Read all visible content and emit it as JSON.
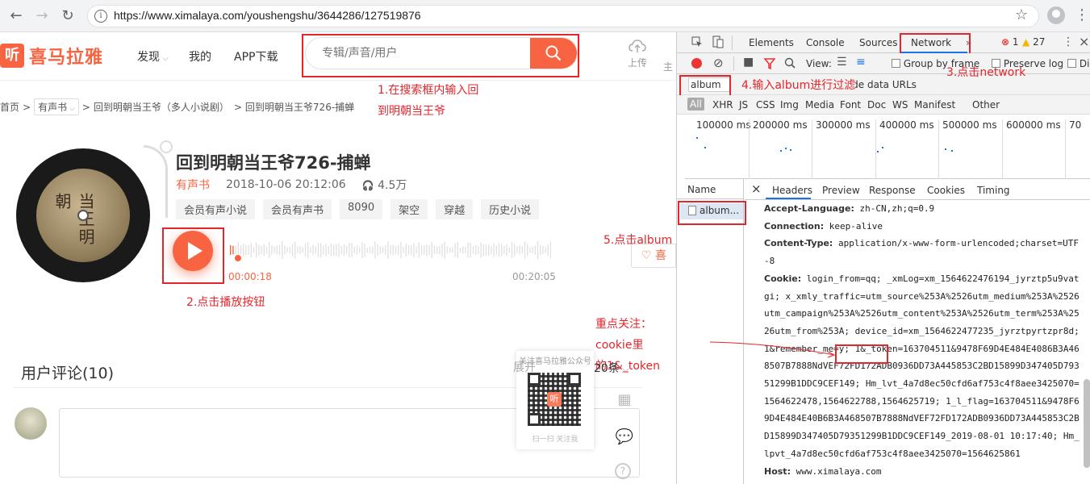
{
  "browser": {
    "url": "https://www.ximalaya.com/youshengshu/3644286/127519876",
    "back_icon": "←",
    "forward_icon": "→",
    "reload_icon": "↻",
    "info_icon": "i",
    "star_icon": "☆",
    "menu_icon": "⋮"
  },
  "site": {
    "logo_mark": "听",
    "logo_text": "喜马拉雅",
    "nav": [
      "发现",
      "我的",
      "APP下载"
    ],
    "search_placeholder": "专辑/声音/用户",
    "upload_label": "上传",
    "host_label": "主",
    "breadcrumb": {
      "home": "首页",
      "sep": ">",
      "category": "有声书",
      "album": "回到明朝当王爷（多人小说剧）",
      "track": "回到明朝当王爷726-捕蝉"
    },
    "cover_text": "当王明朝",
    "track": {
      "title": "回到明朝当王爷726-捕蝉",
      "category": "有声书",
      "date": "2018-10-06 20:12:06",
      "plays": "4.5万",
      "tags": [
        "会员有声小说",
        "会员有声书",
        "8090",
        "架空",
        "穿越",
        "历史小说"
      ],
      "progress_fraction": 0.0149,
      "current_time": "00:00:18",
      "duration": "00:20:05"
    },
    "like_label": "喜",
    "comments": {
      "title": "用户评论(10)",
      "sort": "20条"
    },
    "qr": {
      "overlay_text": "展开",
      "header": "关注喜马拉雅公众号",
      "logo": "听",
      "footer": "扫一扫 关注我"
    },
    "annotations": {
      "a1_line1": "1.在搜索框内输入回",
      "a1_line2": "到明朝当王爷",
      "a2": "2.点击播放按钮",
      "a3": "3.点击network",
      "a4": "4.输入album进行过滤",
      "a5": "5.点击album",
      "focus_line1": "重点关注：cookie里",
      "focus_line2": "的1&_token"
    }
  },
  "devtools": {
    "tabs": [
      "Elements",
      "Console",
      "Sources",
      "Network"
    ],
    "active_tab": "Network",
    "errors": "1",
    "warnings": "27",
    "view_label": "View:",
    "group_by_frame": "Group by frame",
    "preserve_log": "Preserve log",
    "disable_cache": "Di",
    "filter_value": "album",
    "hide_data_urls": "Hide data URLs",
    "types": [
      "All",
      "XHR",
      "JS",
      "CSS",
      "Img",
      "Media",
      "Font",
      "Doc",
      "WS",
      "Manifest",
      "Other"
    ],
    "timeline_ticks": [
      "100000 ms",
      "200000 ms",
      "300000 ms",
      "400000 ms",
      "500000 ms",
      "600000 ms",
      "70"
    ],
    "name_header": "Name",
    "request_name": "album...",
    "detail_tabs": [
      "Headers",
      "Preview",
      "Response",
      "Cookies",
      "Timing"
    ],
    "headers": [
      {
        "k": "Accept-Language:",
        "v": "zh-CN,zh;q=0.9"
      },
      {
        "k": "Connection:",
        "v": "keep-alive"
      },
      {
        "k": "Content-Type:",
        "v": "application/x-www-form-urlencoded;charset=UTF-8"
      },
      {
        "k": "Cookie:",
        "v": "login_from=qq; _xmLog=xm_1564622476194_jyrztp5u9vatgi; x_xmly_traffic=utm_source%253A%2526utm_medium%253A%2526utm_campaign%253A%2526utm_content%253A%2526utm_term%253A%2526utm_from%253A; device_id=xm_1564622477235_jyrztpyrtzpr8d; 1&remember_me=y; 1&_token=163704511&9478F69D4E484E4086B3A468507B7888NdVEF72FD172ADB0936DD73A445853C2BD15899D347405D79351299B1DDC9CEF149; Hm_lvt_4a7d8ec50cfd6af753c4f8aee3425070=1564622478,1564622788,1564625719; 1_l_flag=163704511&9478F69D4E484E40B6B3A468507B7888NdVEF72FD172ADB0936DD73A445853C2BD15899D347405D79351299B1DDC9CEF149_2019-08-01 10:17:40; Hm_lpvt_4a7d8ec50cfd6af753c4f8aee3425070=1564625861"
      },
      {
        "k": "Host:",
        "v": "www.ximalaya.com"
      }
    ]
  }
}
